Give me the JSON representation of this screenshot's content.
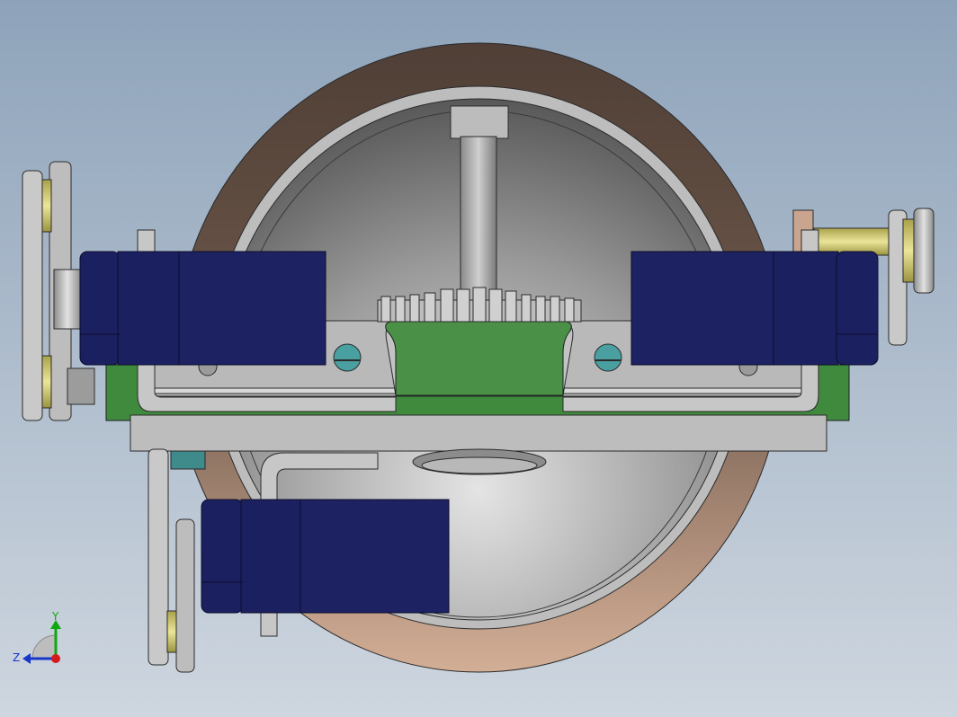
{
  "viewport": {
    "background_top": "#8ea3ba",
    "background_bottom": "#ced6df"
  },
  "colors": {
    "motor_blue": "#1b2160",
    "motor_blue_dark": "#121747",
    "gear_green": "#4a9147",
    "plate_green": "#3f8a3d",
    "wheel_rim": "#5d4b41",
    "wheel_rim_light": "#c9a58f",
    "steel_light": "#c6c6c6",
    "steel_mid": "#a9a9a9",
    "steel_dark": "#6d6d6d",
    "brass": "#d8d27a",
    "teal_screw": "#4aa0a0"
  },
  "icons": {
    "view_triad": "coordinate-triad-icon"
  },
  "triad": {
    "y_label": "Y",
    "z_label": "Z",
    "y_color": "#0fa80f",
    "z_color": "#1836c8",
    "x_color": "#d41a1a"
  }
}
